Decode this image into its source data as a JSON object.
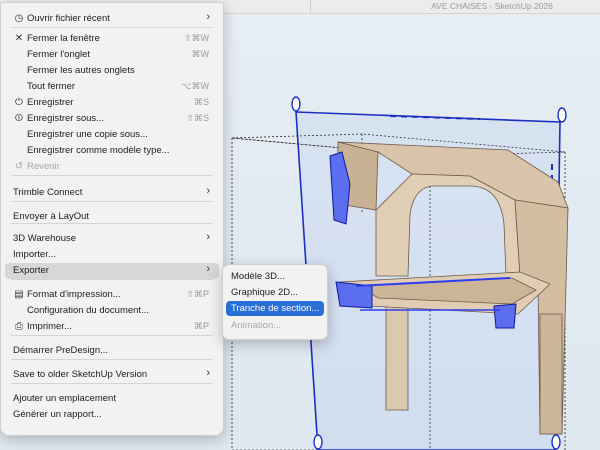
{
  "window": {
    "title": "AVE CHAISES - SketchUp 2026"
  },
  "file_menu": {
    "items": [
      {
        "icon": "clock-icon",
        "glyph": "◷",
        "label": "Ouvrir fichier récent",
        "submenu": true
      },
      {
        "icon": "close-icon",
        "glyph": "✕",
        "label": "Fermer la fenêtre",
        "shortcut": "⇧⌘W"
      },
      {
        "label": "Fermer l'onglet",
        "shortcut": "⌘W"
      },
      {
        "label": "Fermer les autres onglets"
      },
      {
        "label": "Tout fermer",
        "shortcut": "⌥⌘W"
      },
      {
        "icon": "save-icon",
        "glyph": "⏻",
        "label": "Enregistrer",
        "shortcut": "⌘S"
      },
      {
        "icon": "save-as-icon",
        "glyph": "⏼",
        "label": "Enregistrer sous...",
        "shortcut": "⇧⌘S"
      },
      {
        "label": "Enregistrer une copie sous..."
      },
      {
        "label": "Enregistrer comme modèle type..."
      },
      {
        "icon": "revert-icon",
        "glyph": "↺",
        "label": "Revenir",
        "disabled": true
      },
      {
        "label": "Trimble Connect",
        "submenu": true
      },
      {
        "label": "Envoyer à LayOut"
      },
      {
        "label": "3D Warehouse",
        "submenu": true
      },
      {
        "label": "Importer..."
      },
      {
        "label": "Exporter",
        "submenu": true,
        "highlighted": true
      },
      {
        "icon": "page-setup-icon",
        "glyph": "▤",
        "label": "Format d'impression...",
        "shortcut": "⇧⌘P"
      },
      {
        "label": "Configuration du document..."
      },
      {
        "icon": "printer-icon",
        "glyph": "⎙",
        "label": "Imprimer...",
        "shortcut": "⌘P"
      },
      {
        "label": "Démarrer PreDesign..."
      },
      {
        "label": "Save to older SketchUp Version",
        "submenu": true
      },
      {
        "label": "Ajouter un emplacement"
      },
      {
        "label": "Générer un rapport..."
      }
    ]
  },
  "export_submenu": {
    "items": [
      {
        "label": "Modèle 3D..."
      },
      {
        "label": "Graphique 2D..."
      },
      {
        "label": "Tranche de section...",
        "selected": true
      },
      {
        "label": "Animation...",
        "disabled": true
      }
    ]
  },
  "colors": {
    "accent": "#2a6fd6",
    "section_plane": "#1a2fc0",
    "wood": "#d9c4aa",
    "selection_fill": "#5c6ef0"
  }
}
